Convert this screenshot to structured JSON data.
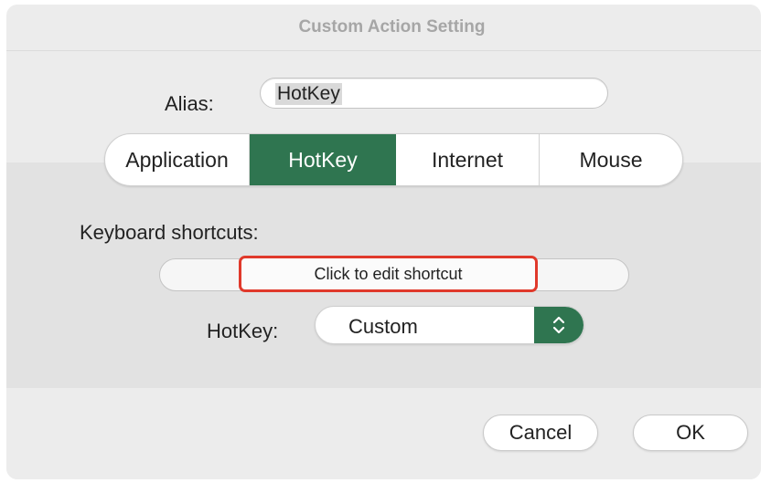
{
  "dialog": {
    "title": "Custom Action Setting"
  },
  "alias": {
    "label": "Alias:",
    "value": "HotKey"
  },
  "tabs": [
    {
      "label": "Application",
      "selected": false
    },
    {
      "label": "HotKey",
      "selected": true
    },
    {
      "label": "Internet",
      "selected": false
    },
    {
      "label": "Mouse",
      "selected": false
    }
  ],
  "shortcut": {
    "label": "Keyboard shortcuts:",
    "button_label": "Click to edit shortcut"
  },
  "hotkey": {
    "label": "HotKey:",
    "selected": "Custom",
    "arrows_icon": "up-down-chevron-icon"
  },
  "buttons": {
    "cancel": "Cancel",
    "ok": "OK"
  },
  "colors": {
    "accent": "#2f7550",
    "highlight_border": "#e0392b"
  }
}
